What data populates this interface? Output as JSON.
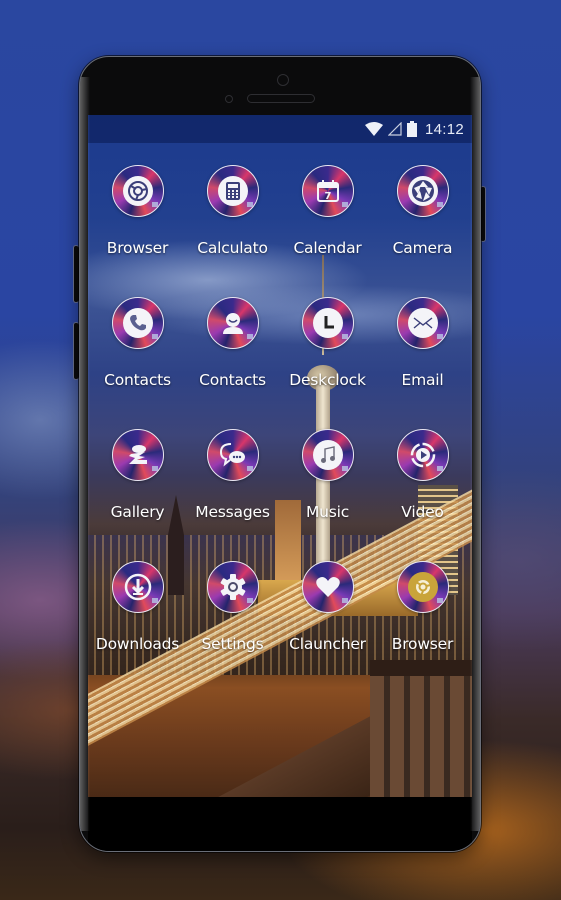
{
  "status_bar": {
    "wifi_icon": "wifi-icon",
    "signal_icon": "signal-icon",
    "battery_icon": "battery-icon",
    "time": "14:12"
  },
  "apps": [
    {
      "label": "Browser",
      "icon": "chrome-icon"
    },
    {
      "label": "Calculato",
      "icon": "calculator-icon"
    },
    {
      "label": "Calendar",
      "icon": "calendar-icon",
      "calendar_day": "7"
    },
    {
      "label": "Camera",
      "icon": "camera-shutter-icon"
    },
    {
      "label": "Contacts",
      "icon": "phone-icon"
    },
    {
      "label": "Contacts",
      "icon": "person-icon"
    },
    {
      "label": "Deskclock",
      "icon": "clock-icon"
    },
    {
      "label": "Email",
      "icon": "envelope-icon"
    },
    {
      "label": "Gallery",
      "icon": "gallery-icon"
    },
    {
      "label": "Messages",
      "icon": "chat-bubble-icon"
    },
    {
      "label": "Music",
      "icon": "music-note-icon"
    },
    {
      "label": "Video",
      "icon": "play-icon"
    },
    {
      "label": "Downloads",
      "icon": "download-icon"
    },
    {
      "label": "Settings",
      "icon": "gear-icon"
    },
    {
      "label": "Clauncher",
      "icon": "heart-icon"
    },
    {
      "label": "Browser",
      "icon": "chrome-icon"
    }
  ],
  "colors": {
    "icon_ring": "#e9e6f2",
    "icon_accent_pink": "#d8366a",
    "icon_accent_purple": "#3a2a8c",
    "label_text": "#ffffff"
  }
}
